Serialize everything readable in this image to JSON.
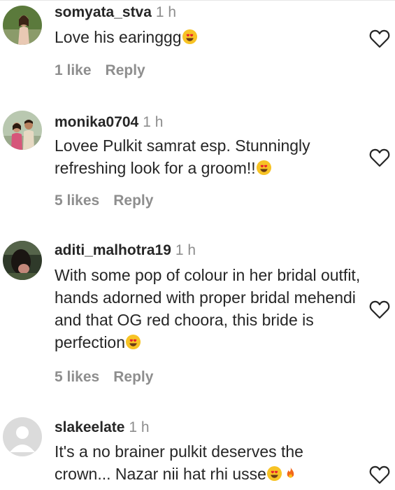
{
  "comments": [
    {
      "username": "somyata_stva",
      "time": "1 h",
      "text": "Love his earinggg",
      "emoji": "heart-eyes",
      "likes": "1 like",
      "reply": "Reply"
    },
    {
      "username": "monika0704",
      "time": "1 h",
      "text": "Lovee Pulkit samrat esp. Stunningly refreshing look for a groom!!",
      "emoji": "heart-eyes",
      "likes": "5 likes",
      "reply": "Reply"
    },
    {
      "username": "aditi_malhotra19",
      "time": "1 h",
      "text": "With some pop of colour in her bridal outfit, hands adorned with proper bridal mehendi and that OG red choora, this bride is perfection",
      "emoji": "heart-eyes",
      "likes": "5 likes",
      "reply": "Reply"
    },
    {
      "username": "slakeelate",
      "time": "1 h",
      "text": "It's a no brainer pulkit deserves the crown... Nazar nii hat rhi usse",
      "emoji": "heart-eyes fire",
      "likes": "",
      "reply": ""
    }
  ],
  "colors": {
    "text": "#262626",
    "muted": "#8e8e8e",
    "emoji": "#f7c325",
    "heart": "#ed4956"
  }
}
